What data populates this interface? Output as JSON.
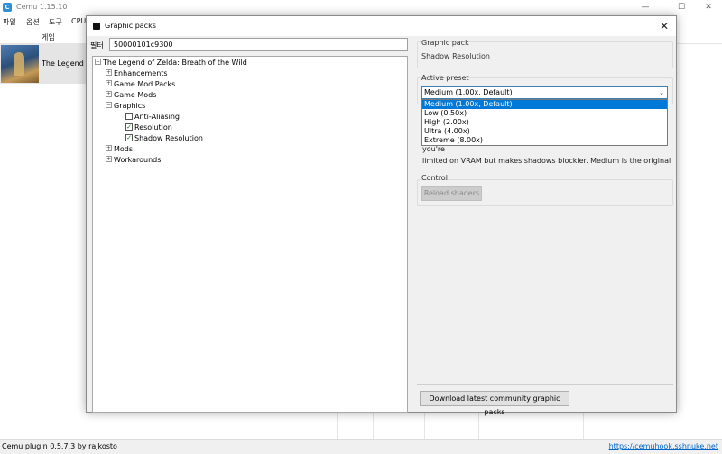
{
  "main_window": {
    "title": "Cemu 1.15.10",
    "app_icon_letter": "C",
    "menu": [
      "파일",
      "옵션",
      "도구",
      "CPU"
    ],
    "game_list": {
      "column_header": "게임",
      "rows": [
        {
          "name": "The Legend of Zelda: Breath of the Wild"
        }
      ]
    },
    "status_left": "Cemu plugin 0.5.7.3 by rajkosto",
    "status_right": "https://cemuhook.sshnuke.net"
  },
  "dialog": {
    "title": "Graphic packs",
    "filter_label": "필터",
    "filter_value": "50000101c9300",
    "tree": {
      "root": "The Legend of Zelda: Breath of the Wild",
      "children": [
        "Enhancements",
        "Game Mod Packs",
        "Game Mods",
        "Graphics",
        "Mods",
        "Workarounds"
      ],
      "graphics_children": [
        {
          "label": "Anti-Aliasing",
          "checked": false
        },
        {
          "label": "Resolution",
          "checked": true
        },
        {
          "label": "Shadow Resolution",
          "checked": true
        }
      ]
    },
    "graphic_pack": {
      "label": "Graphic pack",
      "value": "Shadow Resolution"
    },
    "active_preset": {
      "label": "Active preset",
      "selected": "Medium (1.00x, Default)",
      "options": [
        "Medium (1.00x, Default)",
        "Low (0.50x)",
        "High (2.00x)",
        "Ultra (4.00x)",
        "Extreme (8.00x)"
      ]
    },
    "description": {
      "line1": "you're",
      "line2": "limited on VRAM but makes shadows blockier. Medium is the original"
    },
    "control": {
      "label": "Control",
      "reload_button": "Reload shaders"
    },
    "download_button": "Download latest community graphic packs"
  }
}
